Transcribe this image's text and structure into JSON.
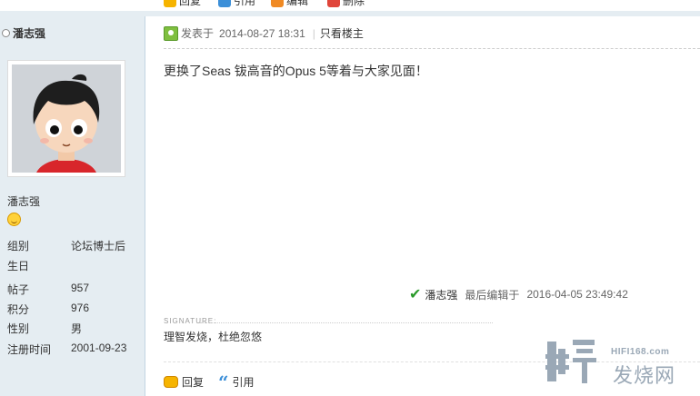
{
  "top_actions": [
    "回复",
    "引用",
    "编辑",
    "删除"
  ],
  "author": {
    "name": "潘志强",
    "name_repeat": "潘志强",
    "stats": [
      {
        "label": "组别",
        "value": "论坛博士后"
      },
      {
        "label": "生日",
        "value": ""
      },
      {
        "label": "帖子",
        "value": "957"
      },
      {
        "label": "积分",
        "value": "976"
      },
      {
        "label": "性别",
        "value": "男"
      },
      {
        "label": "注册时间",
        "value": "2001-09-23"
      }
    ]
  },
  "post": {
    "posted_label": "发表于",
    "posted_time": "2014-08-27 18:31",
    "only_author": "只看楼主",
    "content": "更换了Seas 钹高音的Opus 5等着与大家见面！",
    "edit_user": "潘志强",
    "edit_label": "最后编辑于",
    "edit_time": "2016-04-05 23:49:42",
    "signature_label": "SIGNATURE:",
    "signature": "理智发烧，杜绝忽悠"
  },
  "actions": {
    "reply": "回复",
    "quote": "引用"
  },
  "watermark": {
    "url": "HIFI168.com",
    "name": "发烧网"
  },
  "colors": {
    "sidebar_bg": "#e5edf2",
    "accent_green": "#2a9a2a",
    "quote_blue": "#3c8fd8",
    "reply_yellow": "#f6b400"
  }
}
